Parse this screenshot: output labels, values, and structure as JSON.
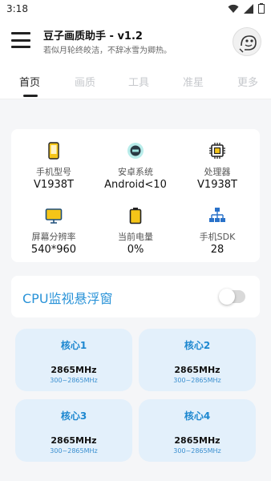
{
  "status_bar": {
    "time": "3:18"
  },
  "header": {
    "title": "豆子画质助手 - v1.2",
    "subtitle": "若似月轮终皎洁，不辞冰雪为卿热。"
  },
  "tabs": [
    {
      "label": "首页",
      "active": true
    },
    {
      "label": "画质",
      "active": false
    },
    {
      "label": "工具",
      "active": false
    },
    {
      "label": "准星",
      "active": false
    },
    {
      "label": "更多",
      "active": false
    }
  ],
  "device_info": [
    {
      "label": "手机型号",
      "value": "V1938T",
      "icon": "phone-icon"
    },
    {
      "label": "安卓系统",
      "value": "Android<10",
      "icon": "android-icon"
    },
    {
      "label": "处理器",
      "value": "V1938T",
      "icon": "cpu-icon"
    },
    {
      "label": "屏幕分辨率",
      "value": "540*960",
      "icon": "monitor-icon"
    },
    {
      "label": "当前电量",
      "value": "0%",
      "icon": "battery-icon"
    },
    {
      "label": "手机SDK",
      "value": "28",
      "icon": "network-icon"
    }
  ],
  "cpu_float": {
    "label": "CPU监视悬浮窗",
    "enabled": false
  },
  "cores": [
    {
      "name": "核心1",
      "freq": "2865MHz",
      "range": "300~2865MHz"
    },
    {
      "name": "核心2",
      "freq": "2865MHz",
      "range": "300~2865MHz"
    },
    {
      "name": "核心3",
      "freq": "2865MHz",
      "range": "300~2865MHz"
    },
    {
      "name": "核心4",
      "freq": "2865MHz",
      "range": "300~2865MHz"
    }
  ],
  "colors": {
    "accent": "#2a93d8",
    "core_bg": "#e3f0fb",
    "icon_yellow": "#f5c518"
  }
}
